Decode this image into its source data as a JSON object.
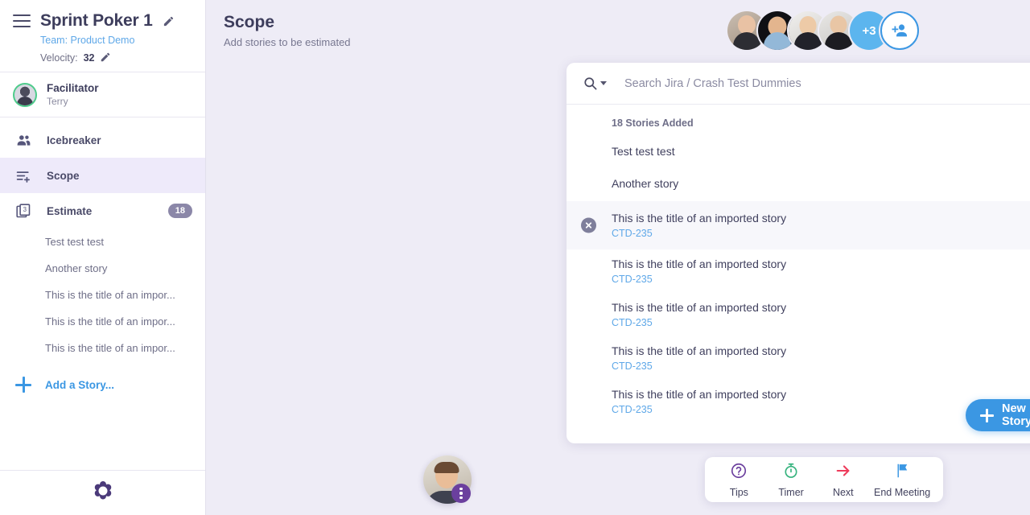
{
  "sidebar": {
    "menu_icon": "hamburger-icon",
    "title": "Sprint Poker 1",
    "edit_title_icon": "pencil-icon",
    "team": "Team: Product Demo",
    "velocity_label": "Velocity:",
    "velocity_value": "32",
    "edit_velocity_icon": "pencil-icon",
    "facilitator": {
      "role": "Facilitator",
      "name": "Terry",
      "ring_color": "#4ecb8b"
    },
    "nav": [
      {
        "label": "Icebreaker",
        "icon": "people-icon",
        "active": false,
        "badge": ""
      },
      {
        "label": "Scope",
        "icon": "list-add-icon",
        "active": true,
        "badge": ""
      },
      {
        "label": "Estimate",
        "icon": "cards-3-icon",
        "active": false,
        "badge": "18"
      }
    ],
    "stories": [
      "Test test test",
      "Another story",
      "This is the title of an impor...",
      "This is the title of an impor...",
      "This is the title of an impor..."
    ],
    "add_story": {
      "label": "Add a Story...",
      "icon": "plus-icon",
      "color": "#3b97e3"
    },
    "logo": "parabol-flower-logo"
  },
  "main": {
    "title": "Scope",
    "subtitle": "Add stories to be estimated",
    "participants": {
      "visible_count": 4,
      "overflow_label": "+3",
      "overflow_color": "#5cb5ee",
      "add_person_icon": "add-person-icon",
      "add_person_color": "#3b97e3"
    },
    "self_video_top": {
      "kebab_icon": "kebab-menu-icon",
      "kebab_color": "#6b3f9e"
    },
    "self_video_bottom": {
      "kebab_icon": "kebab-menu-icon",
      "kebab_color": "#6b3f9e"
    }
  },
  "search": {
    "icon": "search-icon",
    "caret_icon": "chevron-down-icon",
    "placeholder": "Search Jira / Crash Test Dummies",
    "value": "",
    "integration_icon": "jira-logo-icon",
    "integration_caret_icon": "chevron-down-icon"
  },
  "stories_panel": {
    "section_title": "18 Stories Added",
    "rows": [
      {
        "title": "Test test test",
        "key": "",
        "hovered": false,
        "delete_icon": "close-circle-icon"
      },
      {
        "title": "Another story",
        "key": "",
        "hovered": false,
        "delete_icon": "close-circle-icon"
      },
      {
        "title": "This is the title of an imported story",
        "key": "CTD-235",
        "hovered": true,
        "delete_icon": "close-circle-icon"
      },
      {
        "title": "This is the title of an imported story",
        "key": "CTD-235",
        "hovered": false,
        "delete_icon": "close-circle-icon"
      },
      {
        "title": "This is the title of an imported story",
        "key": "CTD-235",
        "hovered": false,
        "delete_icon": "close-circle-icon"
      },
      {
        "title": "This is the title of an imported story",
        "key": "CTD-235",
        "hovered": false,
        "delete_icon": "close-circle-icon"
      },
      {
        "title": "This is the title of an imported story",
        "key": "CTD-235",
        "hovered": false,
        "delete_icon": "close-circle-icon"
      }
    ],
    "new_story_button": {
      "label": "New Story",
      "icon": "plus-icon",
      "color": "#3b97e3"
    }
  },
  "toolbar": [
    {
      "label": "Tips",
      "icon": "question-circle-icon",
      "color": "#6b3f9e"
    },
    {
      "label": "Timer",
      "icon": "stopwatch-icon",
      "color": "#36b37e"
    },
    {
      "label": "Next",
      "icon": "arrow-right-icon",
      "color": "#ee3b5b"
    },
    {
      "label": "End Meeting",
      "icon": "flag-icon",
      "color": "#3b97e3"
    }
  ],
  "colors": {
    "page_background": "#eeecf6",
    "panel_background": "#ffffff",
    "accent_blue": "#3b97e3",
    "link_blue": "#5fa8e8",
    "text_dark": "#3d3d5c",
    "text_muted": "#777790",
    "badge_gray": "#8b87a8",
    "active_nav": "#eeeafa"
  }
}
